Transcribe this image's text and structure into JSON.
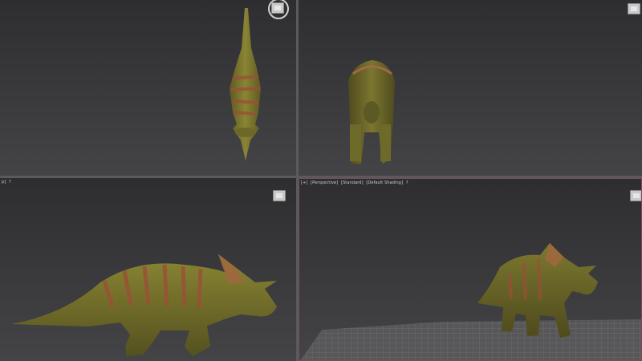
{
  "viewports": {
    "top": {
      "label_parts": []
    },
    "front": {
      "label_parts": []
    },
    "left": {
      "label_parts": [
        "p]",
        "?"
      ]
    },
    "perspective": {
      "label_parts": [
        "[+]",
        "[Perspective]",
        "[Standard]",
        "[Default Shading]",
        "?"
      ]
    }
  },
  "colors": {
    "viewport_bg_top": "#2e2e31",
    "viewport_bg_bottom": "#444447",
    "active_viewport_border": "#7a4a5a",
    "dino_body": "#7f7a2e",
    "dino_stripes": "#a5553a",
    "grid": "#8a8a8c"
  },
  "icons": [
    "viewcube-icon",
    "navigation-ring-icon"
  ]
}
